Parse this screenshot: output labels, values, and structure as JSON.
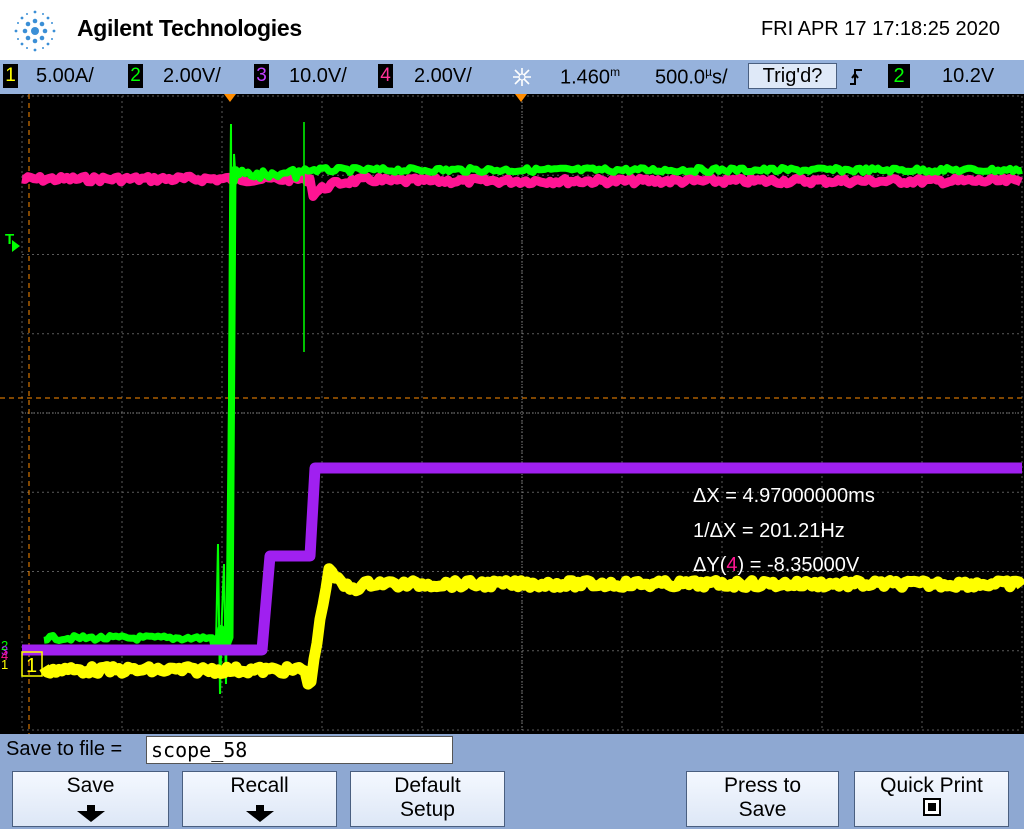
{
  "header": {
    "brand": "Agilent Technologies",
    "datetime": "FRI APR 17 17:18:25 2020"
  },
  "status": {
    "ch1": {
      "num": "1",
      "scale": "5.00A/",
      "color": "#ffff00"
    },
    "ch2": {
      "num": "2",
      "scale": "2.00V/",
      "color": "#00ff00"
    },
    "ch3": {
      "num": "3",
      "scale": "10.0V/",
      "color": "#b000ff"
    },
    "ch4": {
      "num": "4",
      "scale": "2.00V/",
      "color": "#ff1493"
    },
    "delay": "1.460",
    "delay_unit": "m",
    "timebase": "500.0",
    "timebase_unit": "µ",
    "per": "s/",
    "trig_state": "Trig'd?",
    "trig_source": "2",
    "trig_level": "10.2V"
  },
  "screen": {
    "trigger_marker": "T",
    "ref_ch1": "1",
    "ref_ch2": "2",
    "ref_ch3": "3",
    "ref_ch4": "4"
  },
  "measurements": {
    "dx_prefix": "ΔX = ",
    "dx_value": "4.97000000ms",
    "inv_dx_prefix": "1/ΔX = ",
    "inv_dx_value": "201.21Hz",
    "dy_prefix": "ΔY(",
    "dy_channel": "4",
    "dy_suffix": ") = -8.35000V"
  },
  "bottom": {
    "save_label": "Save to file =",
    "filename": "scope_58",
    "buttons": {
      "save": "Save",
      "recall": "Recall",
      "default_line1": "Default",
      "default_line2": "Setup",
      "press_line1": "Press to",
      "press_line2": "Save",
      "quick_print": "Quick Print"
    }
  },
  "colors": {
    "ch1": "#ffff00",
    "ch2": "#00ff00",
    "ch3": "#a020f0",
    "ch4": "#ff1493",
    "grid": "#5a5a5a",
    "cursor": "#ff8c00",
    "bar": "#96b2dc"
  }
}
